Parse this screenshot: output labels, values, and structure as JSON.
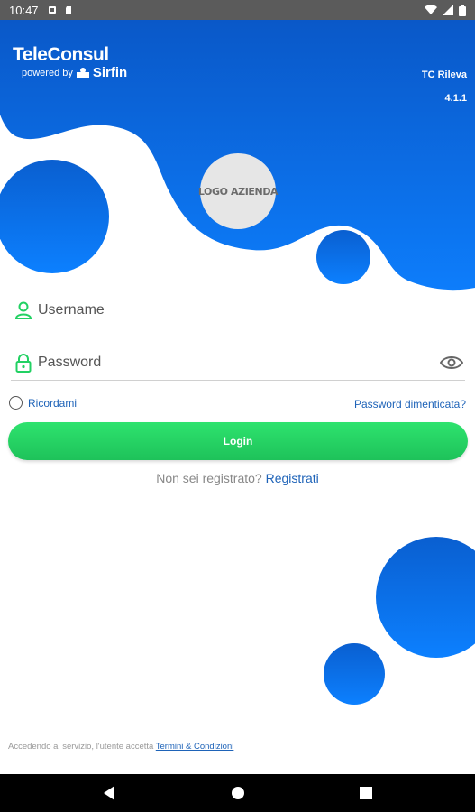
{
  "status_bar": {
    "time": "10:47"
  },
  "brand": {
    "name": "TeleConsul",
    "powered_by": "powered by",
    "partner": "Sirfin"
  },
  "app_info": {
    "name": "TC Rileva",
    "version": "4.1.1"
  },
  "logo_placeholder": "LOGO AZIENDA",
  "form": {
    "username_placeholder": "Username",
    "password_placeholder": "Password",
    "remember_label": "Ricordami",
    "forgot_label": "Password dimenticata?",
    "login_label": "Login",
    "register_prompt": "Non sei registrato?",
    "register_link": "Registrati"
  },
  "footer": {
    "terms_text": "Accedendo al servizio, l'utente accetta",
    "terms_link": "Termini & Condizioni"
  },
  "colors": {
    "primary_blue": "#0a66e0",
    "accent_green": "#22d163",
    "link_blue": "#1e63b8"
  }
}
